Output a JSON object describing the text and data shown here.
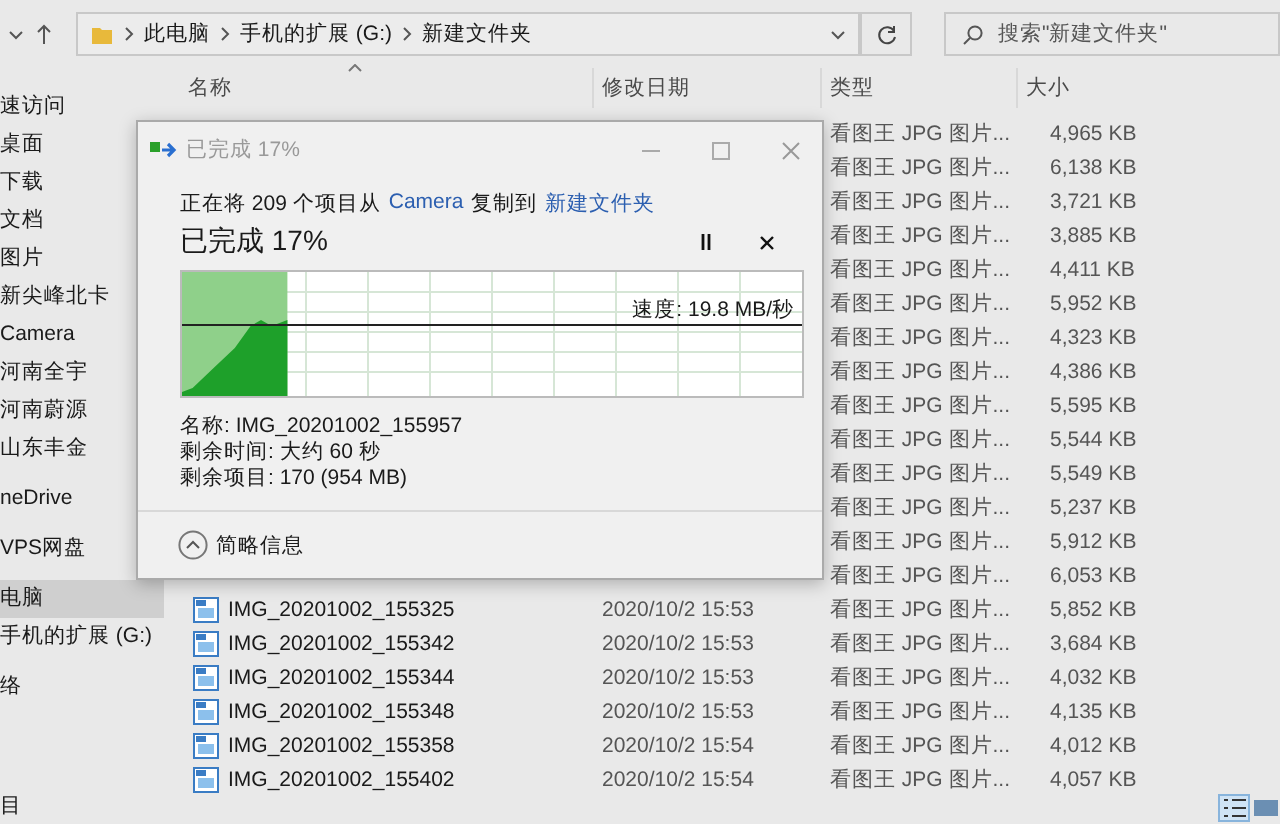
{
  "address_bar": {
    "path": [
      "此电脑",
      "手机的扩展 (G:)",
      "新建文件夹"
    ]
  },
  "search": {
    "placeholder": "搜索\"新建文件夹\""
  },
  "sidebar": {
    "groups": [
      [
        {
          "label": "速访问",
          "selected": false
        },
        {
          "label": "桌面",
          "selected": false
        },
        {
          "label": "下载",
          "selected": false
        },
        {
          "label": "文档",
          "selected": false
        },
        {
          "label": "图片",
          "selected": false
        },
        {
          "label": "新尖峰北卡",
          "selected": false
        },
        {
          "label": "Camera",
          "selected": false
        },
        {
          "label": "河南全宇",
          "selected": false
        },
        {
          "label": "河南蔚源",
          "selected": false
        },
        {
          "label": "山东丰金",
          "selected": false
        }
      ],
      [
        {
          "label": "neDrive",
          "selected": false
        }
      ],
      [
        {
          "label": "VPS网盘",
          "selected": false
        }
      ],
      [
        {
          "label": "电脑",
          "selected": true
        },
        {
          "label": "手机的扩展 (G:)",
          "selected": false
        }
      ],
      [
        {
          "label": "络",
          "selected": false
        }
      ]
    ]
  },
  "columns": [
    "名称",
    "修改日期",
    "类型",
    "大小"
  ],
  "rows": [
    {
      "type": "看图王 JPG 图片...",
      "size": "4,965 KB"
    },
    {
      "type": "看图王 JPG 图片...",
      "size": "6,138 KB"
    },
    {
      "type": "看图王 JPG 图片...",
      "size": "3,721 KB"
    },
    {
      "type": "看图王 JPG 图片...",
      "size": "3,885 KB"
    },
    {
      "type": "看图王 JPG 图片...",
      "size": "4,411 KB"
    },
    {
      "type": "看图王 JPG 图片...",
      "size": "5,952 KB"
    },
    {
      "type": "看图王 JPG 图片...",
      "size": "4,323 KB"
    },
    {
      "type": "看图王 JPG 图片...",
      "size": "4,386 KB"
    },
    {
      "type": "看图王 JPG 图片...",
      "size": "5,595 KB"
    },
    {
      "type": "看图王 JPG 图片...",
      "size": "5,544 KB"
    },
    {
      "type": "看图王 JPG 图片...",
      "size": "5,549 KB"
    },
    {
      "type": "看图王 JPG 图片...",
      "size": "5,237 KB"
    },
    {
      "type": "看图王 JPG 图片...",
      "size": "5,912 KB"
    },
    {
      "type": "看图王 JPG 图片...",
      "size": "6,053 KB"
    },
    {
      "name": "IMG_20201002_155325",
      "date": "2020/10/2 15:53",
      "type": "看图王 JPG 图片...",
      "size": "5,852 KB"
    },
    {
      "name": "IMG_20201002_155342",
      "date": "2020/10/2 15:53",
      "type": "看图王 JPG 图片...",
      "size": "3,684 KB"
    },
    {
      "name": "IMG_20201002_155344",
      "date": "2020/10/2 15:53",
      "type": "看图王 JPG 图片...",
      "size": "4,032 KB"
    },
    {
      "name": "IMG_20201002_155348",
      "date": "2020/10/2 15:53",
      "type": "看图王 JPG 图片...",
      "size": "4,135 KB"
    },
    {
      "name": "IMG_20201002_155358",
      "date": "2020/10/2 15:54",
      "type": "看图王 JPG 图片...",
      "size": "4,012 KB"
    },
    {
      "name": "IMG_20201002_155402",
      "date": "2020/10/2 15:54",
      "type": "看图王 JPG 图片...",
      "size": "4,057 KB"
    }
  ],
  "status_bar": {
    "text": "目"
  },
  "copy_dialog": {
    "title": "已完成 17%",
    "message_start": "正在将 209 个项目从",
    "source": "Camera",
    "message_middle": "复制到",
    "destination": "新建文件夹",
    "heading": "已完成 17%",
    "speed": "速度: 19.8 MB/秒",
    "progress": {
      "level": 0.17
    },
    "details": [
      "名称: IMG_20201002_155957",
      "剩余时间: 大约 60 秒",
      "剩余项目: 170 (954 MB)"
    ],
    "footer": "简略信息"
  }
}
